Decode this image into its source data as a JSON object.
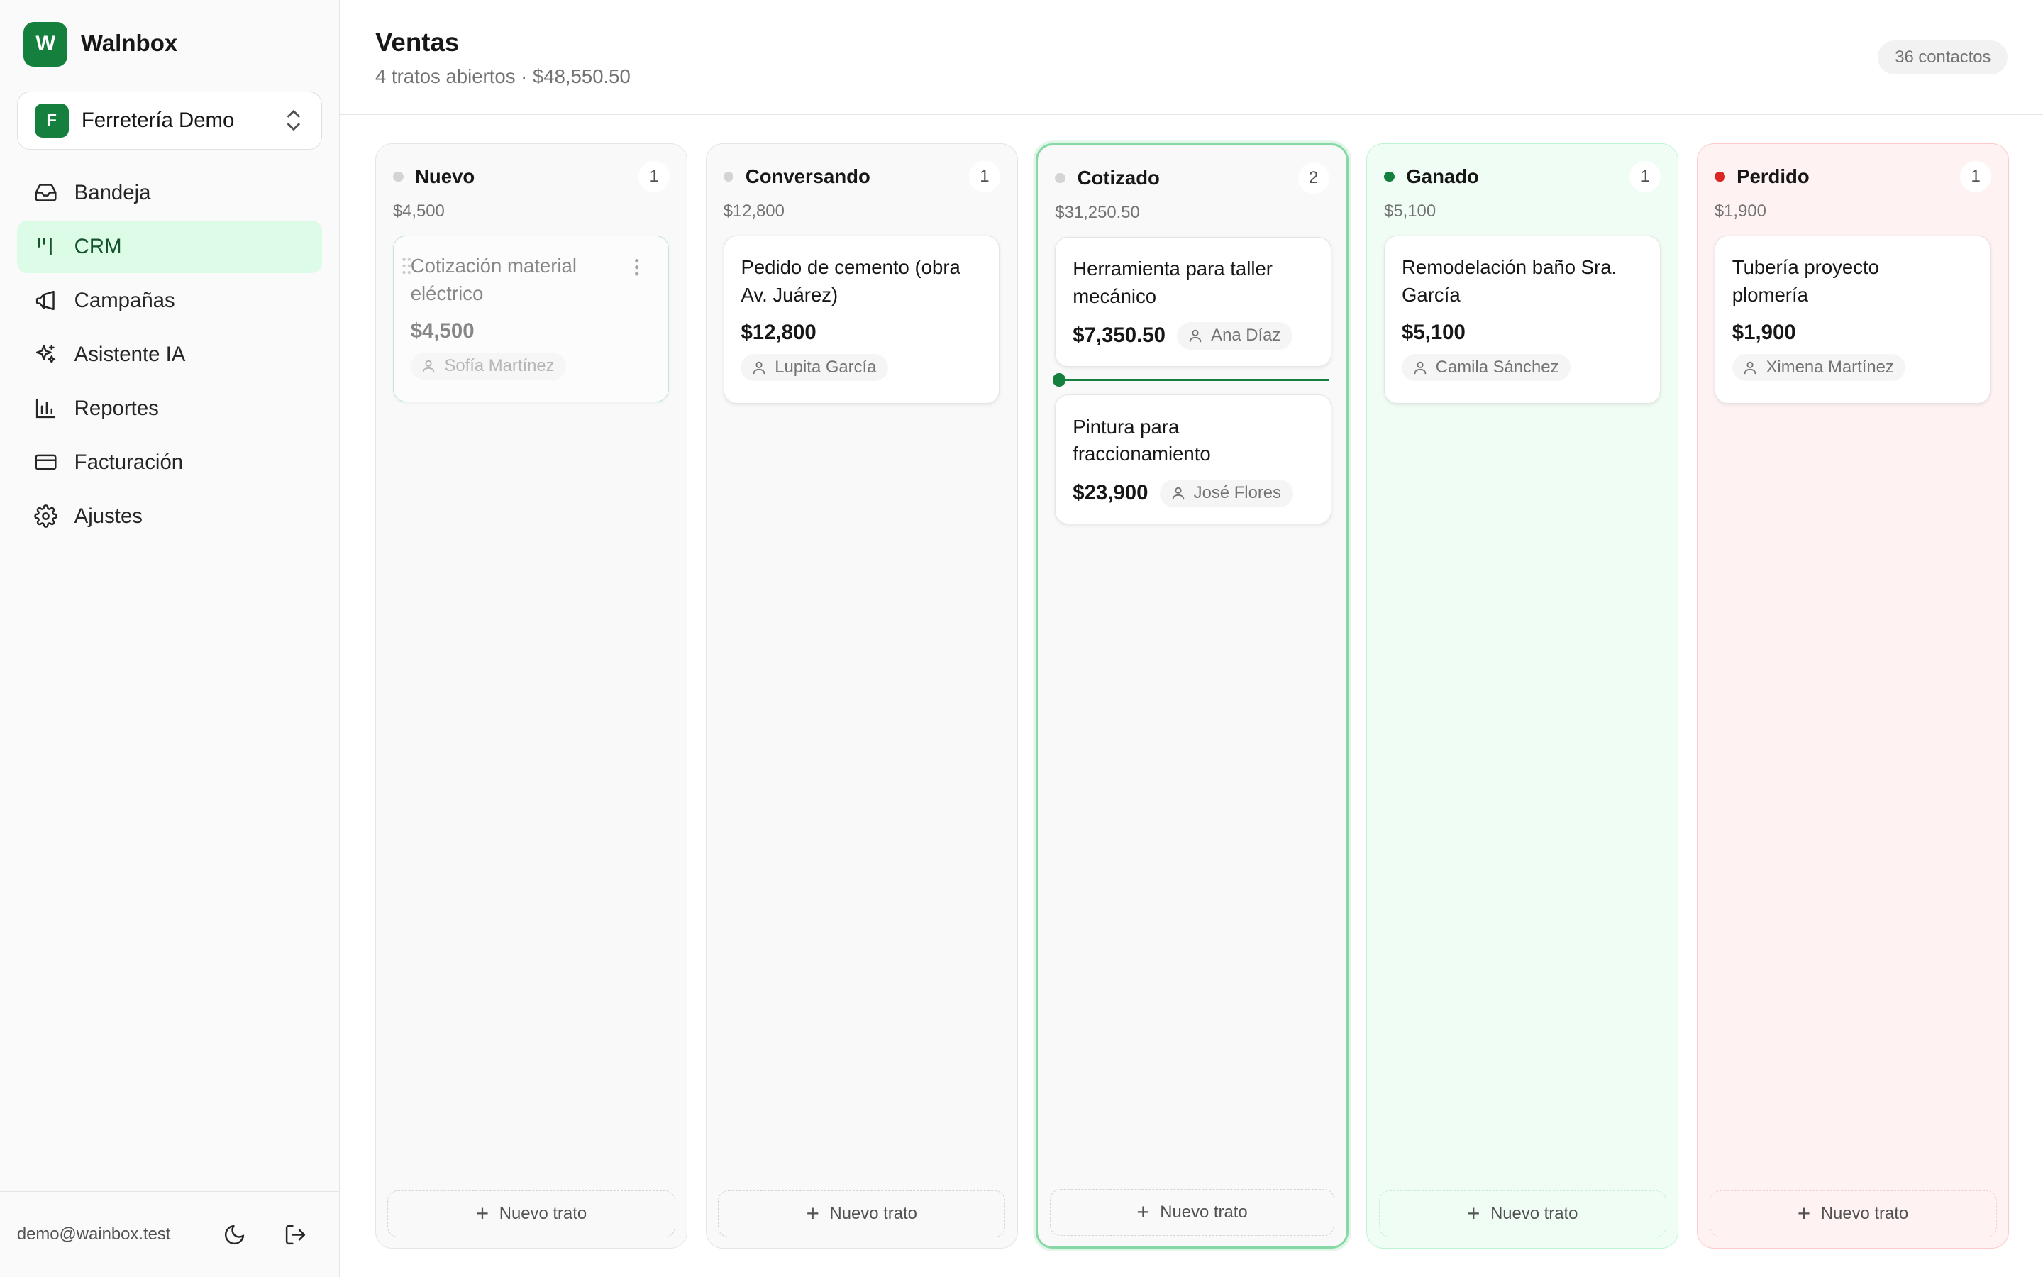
{
  "app": {
    "brand_initial": "W",
    "brand_name": "Walnbox"
  },
  "workspace": {
    "initial": "F",
    "name": "Ferretería Demo"
  },
  "nav": {
    "items": [
      {
        "label": "Bandeja",
        "icon": "inbox-icon",
        "active": false
      },
      {
        "label": "CRM",
        "icon": "kanban-icon",
        "active": true
      },
      {
        "label": "Campañas",
        "icon": "megaphone-icon",
        "active": false
      },
      {
        "label": "Asistente IA",
        "icon": "sparkles-icon",
        "active": false
      },
      {
        "label": "Reportes",
        "icon": "bar-chart-icon",
        "active": false
      },
      {
        "label": "Facturación",
        "icon": "credit-card-icon",
        "active": false
      },
      {
        "label": "Ajustes",
        "icon": "gear-icon",
        "active": false
      }
    ]
  },
  "footer": {
    "email": "demo@wainbox.test"
  },
  "header": {
    "title": "Ventas",
    "subtitle": "4 tratos abiertos · $48,550.50",
    "contacts": "36 contactos"
  },
  "board": {
    "new_deal_label": "Nuevo trato",
    "columns": [
      {
        "title": "Nuevo",
        "count": "1",
        "total": "$4,500",
        "dot": "#d4d4d4",
        "cards": [
          {
            "title": "Cotización material eléctrico",
            "amount": "$4,500",
            "contact": "Sofía Martínez"
          }
        ]
      },
      {
        "title": "Conversando",
        "count": "1",
        "total": "$12,800",
        "dot": "#d4d4d4",
        "cards": [
          {
            "title": "Pedido de cemento (obra Av. Juárez)",
            "amount": "$12,800",
            "contact": "Lupita García"
          }
        ]
      },
      {
        "title": "Cotizado",
        "count": "2",
        "total": "$31,250.50",
        "dot": "#d4d4d4",
        "cards": [
          {
            "title": "Herramienta para taller mecánico",
            "amount": "$7,350.50",
            "contact": "Ana Díaz"
          },
          {
            "title": "Pintura para fraccionamiento",
            "amount": "$23,900",
            "contact": "José Flores"
          }
        ]
      },
      {
        "title": "Ganado",
        "count": "1",
        "total": "$5,100",
        "dot": "#15803d",
        "cards": [
          {
            "title": "Remodelación baño Sra. García",
            "amount": "$5,100",
            "contact": "Camila Sánchez"
          }
        ]
      },
      {
        "title": "Perdido",
        "count": "1",
        "total": "$1,900",
        "dot": "#dc2626",
        "cards": [
          {
            "title": "Tubería proyecto plomería",
            "amount": "$1,900",
            "contact": "Ximena Martínez"
          }
        ]
      }
    ]
  }
}
